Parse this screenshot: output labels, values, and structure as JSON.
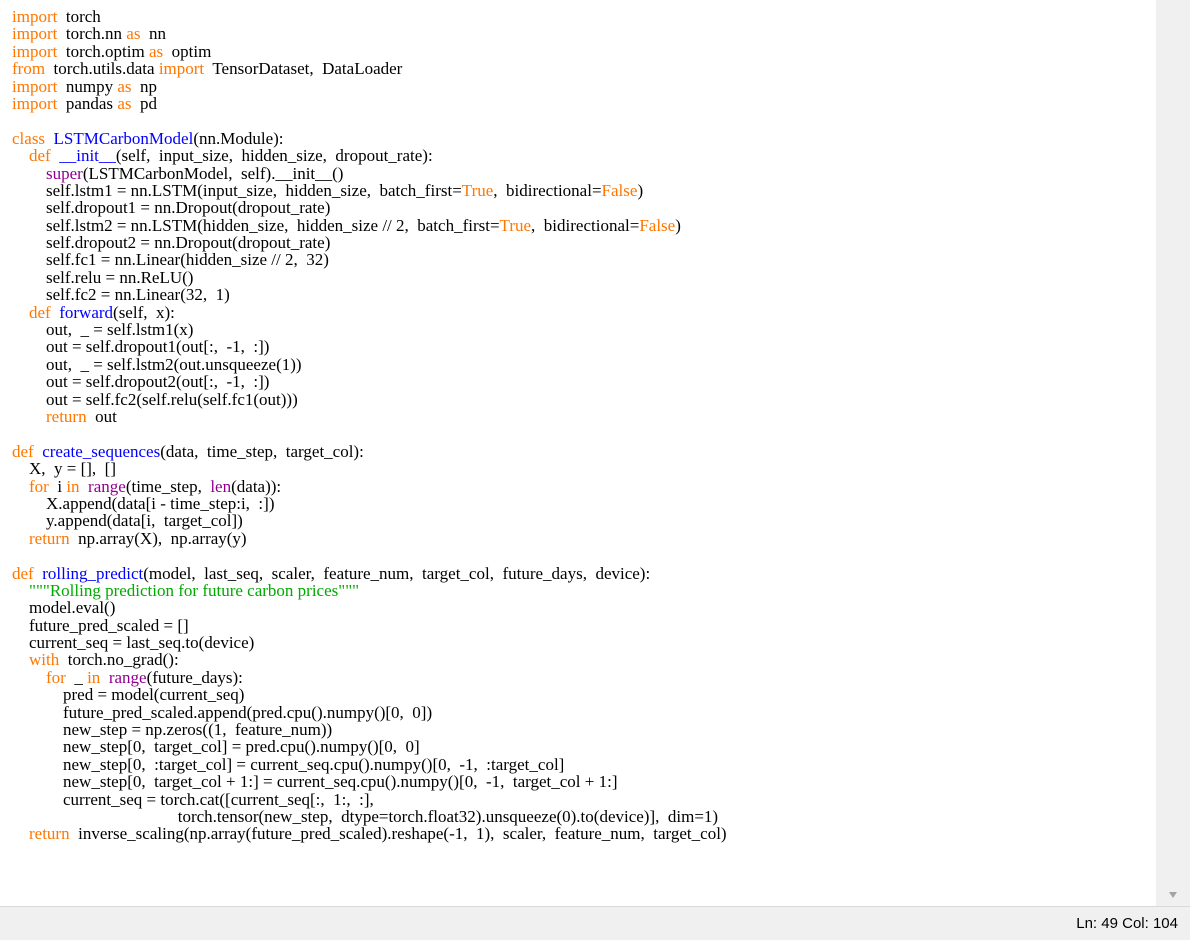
{
  "editor": {
    "cursor_line": 49,
    "lines": [
      [
        [
          "kw",
          "import"
        ],
        [
          "",
          "  torch"
        ]
      ],
      [
        [
          "kw",
          "import"
        ],
        [
          "",
          "  torch.nn "
        ],
        [
          "kw",
          "as"
        ],
        [
          "",
          "  nn"
        ]
      ],
      [
        [
          "kw",
          "import"
        ],
        [
          "",
          "  torch.optim "
        ],
        [
          "kw",
          "as"
        ],
        [
          "",
          "  optim"
        ]
      ],
      [
        [
          "kw",
          "from"
        ],
        [
          "",
          "  torch.utils.data "
        ],
        [
          "kw",
          "import"
        ],
        [
          "",
          "  TensorDataset,  DataLoader"
        ]
      ],
      [
        [
          "kw",
          "import"
        ],
        [
          "",
          "  numpy "
        ],
        [
          "kw",
          "as"
        ],
        [
          "",
          "  np"
        ]
      ],
      [
        [
          "kw",
          "import"
        ],
        [
          "",
          "  pandas "
        ],
        [
          "kw",
          "as"
        ],
        [
          "",
          "  pd"
        ]
      ],
      [],
      [
        [
          "kw",
          "class"
        ],
        [
          "",
          "  "
        ],
        [
          "df",
          "LSTMCarbonModel"
        ],
        [
          "",
          "(nn.Module):"
        ]
      ],
      [
        [
          "",
          "    "
        ],
        [
          "kw",
          "def"
        ],
        [
          "",
          "  "
        ],
        [
          "df",
          "__init__"
        ],
        [
          "",
          "(self,  input_size,  hidden_size,  dropout_rate):"
        ]
      ],
      [
        [
          "",
          "        "
        ],
        [
          "bi",
          "super"
        ],
        [
          "",
          "(LSTMCarbonModel,  self).__init__()"
        ]
      ],
      [
        [
          "",
          "        self.lstm1 = nn.LSTM(input_size,  hidden_size,  batch_first="
        ],
        [
          "kw",
          "True"
        ],
        [
          "",
          ",  bidirectional="
        ],
        [
          "kw",
          "False"
        ],
        [
          "",
          ")"
        ]
      ],
      [
        [
          "",
          "        self.dropout1 = nn.Dropout(dropout_rate)"
        ]
      ],
      [
        [
          "",
          "        self.lstm2 = nn.LSTM(hidden_size,  hidden_size // 2,  batch_first="
        ],
        [
          "kw",
          "True"
        ],
        [
          "",
          ",  bidirectional="
        ],
        [
          "kw",
          "False"
        ],
        [
          "",
          ")"
        ]
      ],
      [
        [
          "",
          "        self.dropout2 = nn.Dropout(dropout_rate)"
        ]
      ],
      [
        [
          "",
          "        self.fc1 = nn.Linear(hidden_size // 2,  32)"
        ]
      ],
      [
        [
          "",
          "        self.relu = nn.ReLU()"
        ]
      ],
      [
        [
          "",
          "        self.fc2 = nn.Linear(32,  1)"
        ]
      ],
      [
        [
          "",
          "    "
        ],
        [
          "kw",
          "def"
        ],
        [
          "",
          "  "
        ],
        [
          "df",
          "forward"
        ],
        [
          "",
          "(self,  x):"
        ]
      ],
      [
        [
          "",
          "        out,  _ = self.lstm1(x)"
        ]
      ],
      [
        [
          "",
          "        out = self.dropout1(out[:,  -1,  :])"
        ]
      ],
      [
        [
          "",
          "        out,  _ = self.lstm2(out.unsqueeze(1))"
        ]
      ],
      [
        [
          "",
          "        out = self.dropout2(out[:,  -1,  :])"
        ]
      ],
      [
        [
          "",
          "        out = self.fc2(self.relu(self.fc1(out)))"
        ]
      ],
      [
        [
          "",
          "        "
        ],
        [
          "kw",
          "return"
        ],
        [
          "",
          "  out"
        ]
      ],
      [],
      [
        [
          "kw",
          "def"
        ],
        [
          "",
          "  "
        ],
        [
          "df",
          "create_sequences"
        ],
        [
          "",
          "(data,  time_step,  target_col):"
        ]
      ],
      [
        [
          "",
          "    X,  y = [],  []"
        ]
      ],
      [
        [
          "",
          "    "
        ],
        [
          "kw",
          "for"
        ],
        [
          "",
          "  i "
        ],
        [
          "kw",
          "in"
        ],
        [
          "",
          "  "
        ],
        [
          "bi",
          "range"
        ],
        [
          "",
          "(time_step,  "
        ],
        [
          "bi",
          "len"
        ],
        [
          "",
          "(data)):"
        ]
      ],
      [
        [
          "",
          "        X.append(data[i - time_step:i,  :])"
        ]
      ],
      [
        [
          "",
          "        y.append(data[i,  target_col])"
        ]
      ],
      [
        [
          "",
          "    "
        ],
        [
          "kw",
          "return"
        ],
        [
          "",
          "  np.array(X),  np.array(y)"
        ]
      ],
      [],
      [
        [
          "kw",
          "def"
        ],
        [
          "",
          "  "
        ],
        [
          "df",
          "rolling_predict"
        ],
        [
          "",
          "(model,  last_seq,  scaler,  feature_num,  target_col,  future_days,  device):"
        ]
      ],
      [
        [
          "",
          "    "
        ],
        [
          "st",
          "\"\"\"Rolling prediction for future carbon prices\"\"\""
        ]
      ],
      [
        [
          "",
          "    model.eval()"
        ]
      ],
      [
        [
          "",
          "    future_pred_scaled = []"
        ]
      ],
      [
        [
          "",
          "    current_seq = last_seq.to(device)"
        ]
      ],
      [
        [
          "",
          "    "
        ],
        [
          "kw",
          "with"
        ],
        [
          "",
          "  torch.no_grad():"
        ]
      ],
      [
        [
          "",
          "        "
        ],
        [
          "kw",
          "for"
        ],
        [
          "",
          "  _ "
        ],
        [
          "kw",
          "in"
        ],
        [
          "",
          "  "
        ],
        [
          "bi",
          "range"
        ],
        [
          "",
          "(future_days):"
        ]
      ],
      [
        [
          "",
          "            pred = model(current_seq)"
        ]
      ],
      [
        [
          "",
          "            future_pred_scaled.append(pred.cpu().numpy()[0,  0])"
        ]
      ],
      [
        [
          "",
          "            new_step = np.zeros((1,  feature_num))"
        ]
      ],
      [
        [
          "",
          "            new_step[0,  target_col] = pred.cpu().numpy()[0,  0]"
        ]
      ],
      [
        [
          "",
          "            new_step[0,  :target_col] = current_seq.cpu().numpy()[0,  -1,  :target_col]"
        ]
      ],
      [
        [
          "",
          "            new_step[0,  target_col + 1:] = current_seq.cpu().numpy()[0,  -1,  target_col + 1:]"
        ]
      ],
      [
        [
          "",
          "            current_seq = torch.cat([current_seq[:,  1:,  :],"
        ]
      ],
      [
        [
          "",
          "                                       torch.tensor(new_step,  dtype=torch.float32).unsqueeze(0).to(device)],  dim=1)"
        ]
      ],
      [
        [
          "",
          "    "
        ],
        [
          "kw",
          "return"
        ],
        [
          "",
          "  inverse_scaling(np.array(future_pred_scaled).reshape(-1,  1),  scaler,  feature_num,  target_col)"
        ]
      ]
    ]
  },
  "statusbar": {
    "position": "Ln: 49  Col: 104"
  }
}
